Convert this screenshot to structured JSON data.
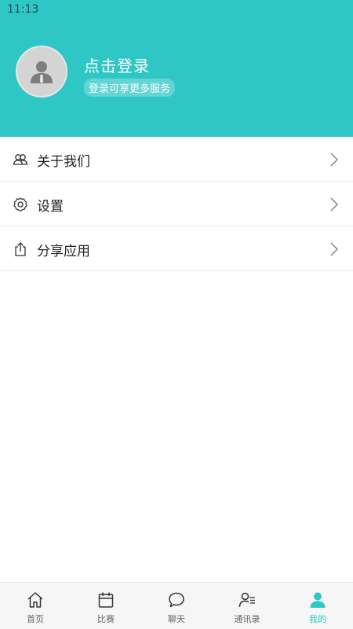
{
  "status_bar": {
    "time": "11:13"
  },
  "header": {
    "title": "点击登录",
    "subtitle": "登录可享更多服务",
    "background_color": "#2ec7c6",
    "avatar_icon": "user-avatar-icon"
  },
  "menu": {
    "items": [
      {
        "label": "关于我们",
        "icon": "users-icon"
      },
      {
        "label": "设置",
        "icon": "gear-icon"
      },
      {
        "label": "分享应用",
        "icon": "share-icon"
      }
    ]
  },
  "tabbar": {
    "active_color": "#2ec7c6",
    "items": [
      {
        "label": "首页",
        "icon": "home-icon",
        "active": false
      },
      {
        "label": "比赛",
        "icon": "calendar-icon",
        "active": false
      },
      {
        "label": "聊天",
        "icon": "chat-bubble-icon",
        "active": false
      },
      {
        "label": "通讯录",
        "icon": "contacts-icon",
        "active": false
      },
      {
        "label": "我的",
        "icon": "profile-icon",
        "active": true
      }
    ]
  }
}
